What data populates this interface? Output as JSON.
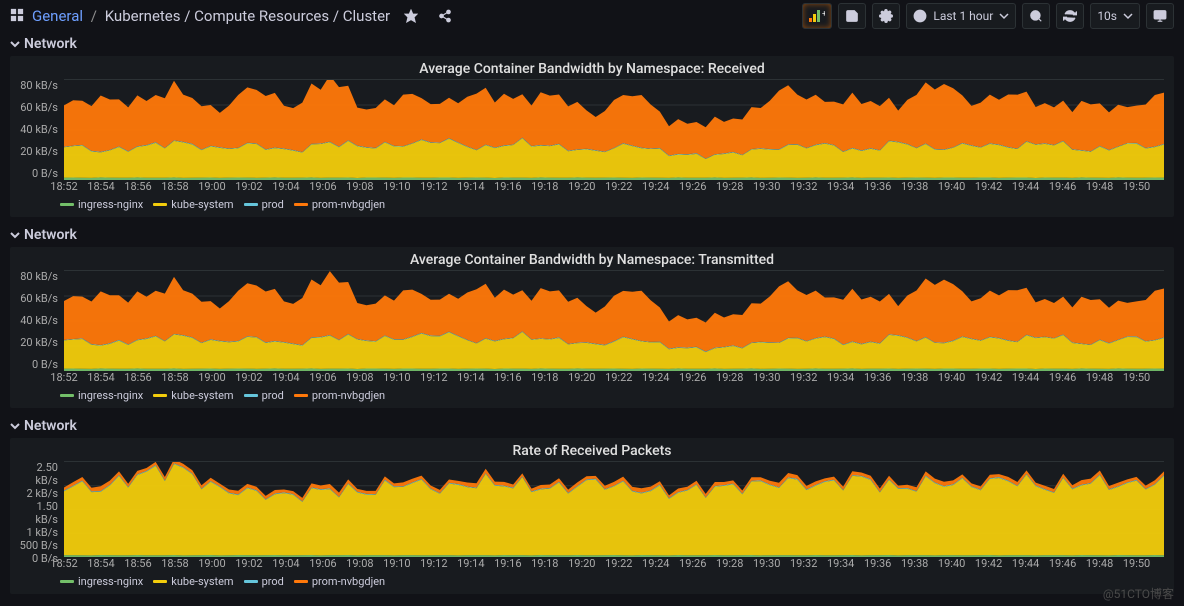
{
  "breadcrumb": {
    "root": "General",
    "page": "Kubernetes / Compute Resources / Cluster"
  },
  "toolbar": {
    "time_range": "Last 1 hour",
    "refresh_interval": "10s"
  },
  "rows": {
    "r1": "Network",
    "r2": "Network",
    "r3": "Network"
  },
  "panels": {
    "p1": "Average Container Bandwidth by Namespace: Received",
    "p2": "Average Container Bandwidth by Namespace: Transmitted",
    "p3": "Rate of Received Packets"
  },
  "legend": {
    "s1": "ingress-nginx",
    "s2": "kube-system",
    "s3": "prod",
    "s4": "prom-nvbgdjen"
  },
  "colors": {
    "s1": "#73BF69",
    "s2": "#F2CC0C",
    "s3": "#65c5db",
    "s4": "#FF780A"
  },
  "x_ticks": [
    "18:52",
    "18:54",
    "18:56",
    "18:58",
    "19:00",
    "19:02",
    "19:04",
    "19:06",
    "19:08",
    "19:10",
    "19:12",
    "19:14",
    "19:16",
    "19:18",
    "19:20",
    "19:22",
    "19:24",
    "19:26",
    "19:28",
    "19:30",
    "19:32",
    "19:34",
    "19:36",
    "19:38",
    "19:40",
    "19:42",
    "19:44",
    "19:46",
    "19:48",
    "19:50"
  ],
  "y12": [
    "80 kB/s",
    "60 kB/s",
    "40 kB/s",
    "20 kB/s",
    "0 B/s"
  ],
  "y3": [
    "2.50 kB/s",
    "2 kB/s",
    "1.50 kB/s",
    "1 kB/s",
    "500 B/s",
    "0 B/s"
  ],
  "watermark": "@51CTO博客",
  "chart_data": [
    {
      "type": "area",
      "title": "Average Container Bandwidth by Namespace: Received",
      "xlabel": "",
      "ylabel": "",
      "ylim": [
        0,
        85
      ],
      "y_unit": "kB/s",
      "x": [
        "18:52",
        "18:54",
        "18:56",
        "18:58",
        "19:00",
        "19:02",
        "19:04",
        "19:06",
        "19:08",
        "19:10",
        "19:12",
        "19:14",
        "19:16",
        "19:18",
        "19:20",
        "19:22",
        "19:24",
        "19:26",
        "19:28",
        "19:30",
        "19:32",
        "19:34",
        "19:36",
        "19:38",
        "19:40",
        "19:42",
        "19:44",
        "19:46",
        "19:48",
        "19:50"
      ],
      "series": [
        {
          "name": "ingress-nginx",
          "color": "#73BF69",
          "values": [
            2,
            2,
            2,
            2,
            2,
            2,
            2,
            2,
            2,
            2,
            2,
            2,
            2,
            2,
            2,
            2,
            2,
            2,
            2,
            2,
            2,
            2,
            2,
            2,
            2,
            2,
            2,
            2,
            2,
            2
          ]
        },
        {
          "name": "kube-system",
          "color": "#F2CC0C",
          "values": [
            28,
            22,
            26,
            30,
            24,
            28,
            22,
            30,
            26,
            28,
            32,
            24,
            30,
            26,
            22,
            28,
            20,
            18,
            22,
            26,
            28,
            22,
            30,
            24,
            28,
            26,
            30,
            22,
            28,
            26
          ]
        },
        {
          "name": "prod",
          "color": "#65c5db",
          "values": [
            0.5,
            0.5,
            0.5,
            0.5,
            0.5,
            0.5,
            0.5,
            0.5,
            0.5,
            0.5,
            0.5,
            0.5,
            0.5,
            0.5,
            0.5,
            0.5,
            0.5,
            0.5,
            0.5,
            0.5,
            0.5,
            0.5,
            0.5,
            0.5,
            0.5,
            0.5,
            0.5,
            0.5,
            0.5,
            0.5
          ]
        },
        {
          "name": "prom-nvbgdjen",
          "color": "#FF780A",
          "values": [
            34,
            44,
            38,
            46,
            30,
            50,
            36,
            56,
            30,
            42,
            30,
            48,
            36,
            44,
            30,
            46,
            26,
            28,
            30,
            50,
            36,
            44,
            30,
            58,
            34,
            46,
            30,
            40,
            30,
            44
          ]
        }
      ],
      "note": "Stacked area; totals peak ~80 kB/s"
    },
    {
      "type": "area",
      "title": "Average Container Bandwidth by Namespace: Transmitted",
      "ylim": [
        0,
        85
      ],
      "y_unit": "kB/s",
      "x": [
        "18:52",
        "18:54",
        "18:56",
        "18:58",
        "19:00",
        "19:02",
        "19:04",
        "19:06",
        "19:08",
        "19:10",
        "19:12",
        "19:14",
        "19:16",
        "19:18",
        "19:20",
        "19:22",
        "19:24",
        "19:26",
        "19:28",
        "19:30",
        "19:32",
        "19:34",
        "19:36",
        "19:38",
        "19:40",
        "19:42",
        "19:44",
        "19:46",
        "19:48",
        "19:50"
      ],
      "series": [
        {
          "name": "ingress-nginx",
          "color": "#73BF69",
          "values": [
            2,
            2,
            2,
            2,
            2,
            2,
            2,
            2,
            2,
            2,
            2,
            2,
            2,
            2,
            2,
            2,
            2,
            2,
            2,
            2,
            2,
            2,
            2,
            2,
            2,
            2,
            2,
            2,
            2,
            2
          ]
        },
        {
          "name": "kube-system",
          "color": "#F2CC0C",
          "values": [
            26,
            20,
            24,
            28,
            22,
            26,
            20,
            28,
            24,
            26,
            30,
            22,
            28,
            24,
            20,
            26,
            18,
            16,
            20,
            24,
            26,
            20,
            28,
            22,
            26,
            24,
            28,
            20,
            26,
            24
          ]
        },
        {
          "name": "prod",
          "color": "#65c5db",
          "values": [
            0.5,
            0.5,
            0.5,
            0.5,
            0.5,
            0.5,
            0.5,
            0.5,
            0.5,
            0.5,
            0.5,
            0.5,
            0.5,
            0.5,
            0.5,
            0.5,
            0.5,
            0.5,
            0.5,
            0.5,
            0.5,
            0.5,
            0.5,
            0.5,
            0.5,
            0.5,
            0.5,
            0.5,
            0.5,
            0.5
          ]
        },
        {
          "name": "prom-nvbgdjen",
          "color": "#FF780A",
          "values": [
            32,
            42,
            36,
            44,
            28,
            48,
            34,
            54,
            28,
            40,
            28,
            46,
            34,
            42,
            28,
            44,
            24,
            26,
            28,
            48,
            34,
            42,
            28,
            56,
            32,
            44,
            28,
            38,
            28,
            42
          ]
        }
      ]
    },
    {
      "type": "area",
      "title": "Rate of Received Packets",
      "ylim": [
        0,
        2.6
      ],
      "y_unit": "kB/s",
      "x": [
        "18:52",
        "18:54",
        "18:56",
        "18:58",
        "19:00",
        "19:02",
        "19:04",
        "19:06",
        "19:08",
        "19:10",
        "19:12",
        "19:14",
        "19:16",
        "19:18",
        "19:20",
        "19:22",
        "19:24",
        "19:26",
        "19:28",
        "19:30",
        "19:32",
        "19:34",
        "19:36",
        "19:38",
        "19:40",
        "19:42",
        "19:44",
        "19:46",
        "19:48",
        "19:50"
      ],
      "series": [
        {
          "name": "ingress-nginx",
          "color": "#73BF69",
          "values": [
            0.05,
            0.05,
            0.05,
            0.05,
            0.05,
            0.05,
            0.05,
            0.05,
            0.05,
            0.05,
            0.05,
            0.05,
            0.05,
            0.05,
            0.05,
            0.05,
            0.05,
            0.05,
            0.05,
            0.05,
            0.05,
            0.05,
            0.05,
            0.05,
            0.05,
            0.05,
            0.05,
            0.05,
            0.05,
            0.05
          ]
        },
        {
          "name": "kube-system",
          "color": "#F2CC0C",
          "values": [
            1.9,
            1.8,
            2.2,
            2.4,
            1.8,
            1.7,
            1.6,
            1.8,
            1.7,
            2.0,
            1.8,
            2.0,
            1.9,
            1.8,
            2.0,
            1.8,
            1.7,
            1.8,
            1.9,
            2.0,
            1.9,
            2.1,
            1.8,
            2.0,
            1.9,
            2.1,
            1.8,
            2.0,
            1.9,
            2.0
          ]
        },
        {
          "name": "prod",
          "color": "#65c5db",
          "values": [
            0.02,
            0.02,
            0.02,
            0.02,
            0.02,
            0.02,
            0.02,
            0.02,
            0.02,
            0.02,
            0.02,
            0.02,
            0.02,
            0.02,
            0.02,
            0.02,
            0.02,
            0.02,
            0.02,
            0.02,
            0.02,
            0.02,
            0.02,
            0.02,
            0.02,
            0.02,
            0.02,
            0.02,
            0.02,
            0.02
          ]
        },
        {
          "name": "prom-nvbgdjen",
          "color": "#FF780A",
          "values": [
            0.08,
            0.12,
            0.08,
            0.1,
            0.08,
            0.1,
            0.08,
            0.12,
            0.08,
            0.1,
            0.08,
            0.12,
            0.08,
            0.1,
            0.08,
            0.12,
            0.08,
            0.1,
            0.08,
            0.12,
            0.08,
            0.1,
            0.08,
            0.12,
            0.08,
            0.1,
            0.08,
            0.12,
            0.08,
            0.1
          ]
        }
      ]
    }
  ]
}
